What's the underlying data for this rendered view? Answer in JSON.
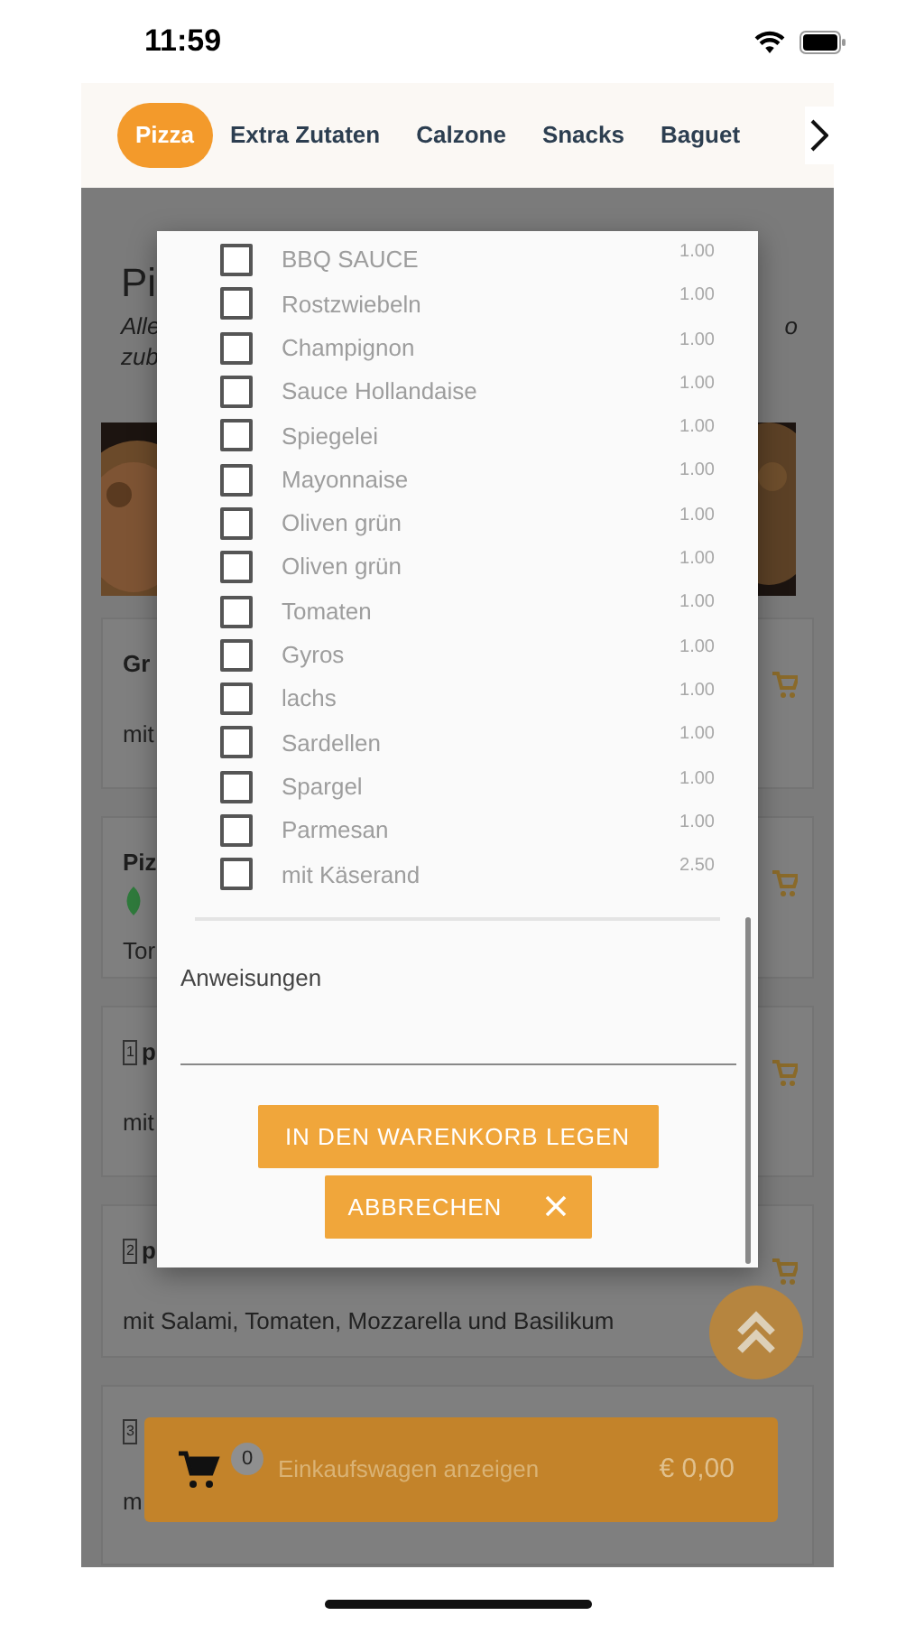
{
  "status_bar": {
    "time": "11:59"
  },
  "tabs": [
    {
      "label": "Pizza",
      "selected": true
    },
    {
      "label": "Extra Zutaten",
      "selected": false
    },
    {
      "label": "Calzone",
      "selected": false
    },
    {
      "label": "Snacks",
      "selected": false
    },
    {
      "label": "Baguet",
      "selected": false
    }
  ],
  "background": {
    "heading": "Pi",
    "intro_left": [
      "Alle",
      "zub"
    ],
    "intro_right": "o",
    "cards": [
      {
        "title": "Gr",
        "description": "mit"
      },
      {
        "title": "Piz",
        "vegetarian": true,
        "description": "Tor"
      },
      {
        "number": "1",
        "title": "p",
        "description": "mit"
      },
      {
        "number": "2",
        "title": "p",
        "description": "mit Salami, Tomaten, Mozzarella und Basilikum"
      },
      {
        "number": "3",
        "description": "m"
      }
    ]
  },
  "modal": {
    "options": [
      {
        "label": "BBQ SAUCE",
        "price": "1.00",
        "checked": false
      },
      {
        "label": "Rostzwiebeln",
        "price": "1.00",
        "checked": false
      },
      {
        "label": "Champignon",
        "price": "1.00",
        "checked": false
      },
      {
        "label": "Sauce Hollandaise",
        "price": "1.00",
        "checked": false
      },
      {
        "label": "Spiegelei",
        "price": "1.00",
        "checked": false
      },
      {
        "label": "Mayonnaise",
        "price": "1.00",
        "checked": false
      },
      {
        "label": "Oliven grün",
        "price": "1.00",
        "checked": false
      },
      {
        "label": "Oliven grün",
        "price": "1.00",
        "checked": false
      },
      {
        "label": "Tomaten",
        "price": "1.00",
        "checked": false
      },
      {
        "label": "Gyros",
        "price": "1.00",
        "checked": false
      },
      {
        "label": "lachs",
        "price": "1.00",
        "checked": false
      },
      {
        "label": "Sardellen",
        "price": "1.00",
        "checked": false
      },
      {
        "label": "Spargel",
        "price": "1.00",
        "checked": false
      },
      {
        "label": "Parmesan",
        "price": "1.00",
        "checked": false
      },
      {
        "label": "mit Käserand",
        "price": "2.50",
        "checked": false
      }
    ],
    "instructions_label": "Anweisungen",
    "add_button": "IN DEN WARENKORB LEGEN",
    "cancel_button": "ABBRECHEN"
  },
  "cart_bar": {
    "count": "0",
    "label": "Einkaufswagen anzeigen",
    "total": "€ 0,00"
  }
}
